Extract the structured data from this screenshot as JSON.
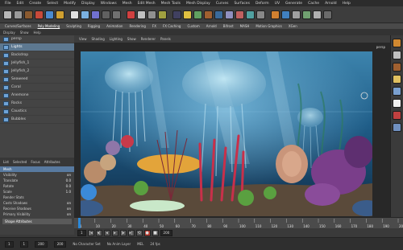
{
  "menubar": [
    "File",
    "Edit",
    "Create",
    "Select",
    "Modify",
    "Display",
    "Windows",
    "Mesh",
    "Edit Mesh",
    "Mesh Tools",
    "Mesh Display",
    "Curves",
    "Surfaces",
    "Deform",
    "UV",
    "Generate",
    "Cache",
    "Arnold",
    "Help"
  ],
  "shelf_icons": [
    {
      "name": "select-icon",
      "color": "#b8b8b8"
    },
    {
      "name": "lasso-icon",
      "color": "#9a9a9a"
    },
    {
      "name": "paint-icon",
      "color": "#8a5a30"
    },
    {
      "name": "move-icon",
      "color": "#c84a3a"
    },
    {
      "name": "rotate-icon",
      "color": "#4a8ad0"
    },
    {
      "name": "scale-icon",
      "color": "#d0a030"
    },
    {
      "name": "sphere-icon",
      "color": "#e0e0e0"
    },
    {
      "name": "cube-icon",
      "color": "#7ab0e0"
    },
    {
      "name": "cylinder-icon",
      "color": "#7070d0"
    },
    {
      "name": "snap-grid-icon",
      "color": "#606060"
    },
    {
      "name": "snap-curve-icon",
      "color": "#707070"
    },
    {
      "name": "render-icon",
      "color": "#d04040"
    },
    {
      "name": "ipr-icon",
      "color": "#c0c0c0"
    },
    {
      "name": "render-settings-icon",
      "color": "#909090"
    },
    {
      "name": "hypershade-icon",
      "color": "#a0a040"
    },
    {
      "name": "camera-icon",
      "color": "#404060"
    },
    {
      "name": "light-icon",
      "color": "#e0c040"
    },
    {
      "name": "material-icon",
      "color": "#60a060"
    },
    {
      "name": "texture-icon",
      "color": "#a06030"
    },
    {
      "name": "deformer-icon",
      "color": "#3a6a9a"
    },
    {
      "name": "joint-icon",
      "color": "#9090c0"
    },
    {
      "name": "ik-icon",
      "color": "#c06060"
    },
    {
      "name": "cluster-icon",
      "color": "#50a0a0"
    },
    {
      "name": "lattice-icon",
      "color": "#888888"
    },
    {
      "name": "particle-icon",
      "color": "#d08030"
    },
    {
      "name": "fluid-icon",
      "color": "#4080c0"
    },
    {
      "name": "hair-icon",
      "color": "#a0a0a0"
    },
    {
      "name": "cloth-icon",
      "color": "#70a070"
    },
    {
      "name": "settings-icon",
      "color": "#b0b0b0"
    },
    {
      "name": "help-icon",
      "color": "#6a6a6a"
    }
  ],
  "tabs": [
    "Curves/Surfaces",
    "Poly Modeling",
    "Sculpting",
    "Rigging",
    "Animation",
    "Rendering",
    "FX",
    "FX Caching",
    "Custom",
    "Arnold",
    "Bifrost",
    "MASH",
    "Motion Graphics",
    "XGen"
  ],
  "active_tab": "Poly Modeling",
  "panel_menu": [
    "Display",
    "Show",
    "Help"
  ],
  "outliner": [
    {
      "label": "persp",
      "selected": false
    },
    {
      "label": "Lights",
      "selected": true
    },
    {
      "label": "Backdrop",
      "selected": false
    },
    {
      "label": "Jellyfish_1",
      "selected": false
    },
    {
      "label": "Jellyfish_2",
      "selected": false
    },
    {
      "label": "Seaweed",
      "selected": false
    },
    {
      "label": "Coral",
      "selected": false
    },
    {
      "label": "Anemone",
      "selected": false
    },
    {
      "label": "Rocks",
      "selected": false
    },
    {
      "label": "Caustics",
      "selected": false
    },
    {
      "label": "Bubbles",
      "selected": false
    }
  ],
  "attr": {
    "tabs": [
      "List",
      "Selected",
      "Focus",
      "Attributes"
    ],
    "rows": [
      {
        "label": "Mesh",
        "value": ""
      },
      {
        "label": "Visibility",
        "value": "on"
      },
      {
        "label": "Translate",
        "value": "0.0"
      },
      {
        "label": "Rotate",
        "value": "0.0"
      },
      {
        "label": "Scale",
        "value": "1.0"
      },
      {
        "label": "Render Stats",
        "value": ""
      },
      {
        "label": "Casts Shadows",
        "value": "on"
      },
      {
        "label": "Receive Shadows",
        "value": "on"
      },
      {
        "label": "Primary Visibility",
        "value": "on"
      }
    ],
    "group_title": "Shape Attributes"
  },
  "viewport": {
    "menu": [
      "View",
      "Shading",
      "Lighting",
      "Show",
      "Renderer",
      "Panels"
    ],
    "camera_label": "persp"
  },
  "right_shelf_icons": [
    {
      "name": "channel-box-icon",
      "color": "#d08830"
    },
    {
      "name": "layer-icon",
      "color": "#c0c0c0"
    },
    {
      "name": "attribute-editor-icon",
      "color": "#a06030"
    },
    {
      "name": "tool-settings-icon",
      "color": "#e0c060"
    },
    {
      "name": "modeling-toolkit-icon",
      "color": "#7aa0d0"
    },
    {
      "name": "render-view-icon",
      "color": "#f0f0f0"
    },
    {
      "name": "hypershade-side-icon",
      "color": "#c04040"
    },
    {
      "name": "node-editor-icon",
      "color": "#7090c0"
    }
  ],
  "timeline": {
    "ticks": [
      "1",
      "10",
      "20",
      "30",
      "40",
      "50",
      "60",
      "70",
      "80",
      "90",
      "100",
      "110",
      "120",
      "130",
      "140",
      "150",
      "160",
      "170",
      "180",
      "190",
      "200"
    ],
    "current": "1"
  },
  "playback": {
    "start": "1",
    "end": "200",
    "buttons": [
      "first-frame",
      "prev-key",
      "play-back",
      "play-forward",
      "next-key",
      "last-frame",
      "loop",
      "auto-key",
      "stop"
    ]
  },
  "status": {
    "labels": [
      "No Character Set",
      "No Anim Layer",
      "MEL",
      "24 fps"
    ],
    "frame_fields": [
      "1",
      "1",
      "200",
      "200"
    ]
  },
  "colors": {
    "accent": "#5d7890",
    "water_top": "#2f6f9a",
    "water_deep": "#163c60",
    "sand": "#8a6e4a"
  }
}
